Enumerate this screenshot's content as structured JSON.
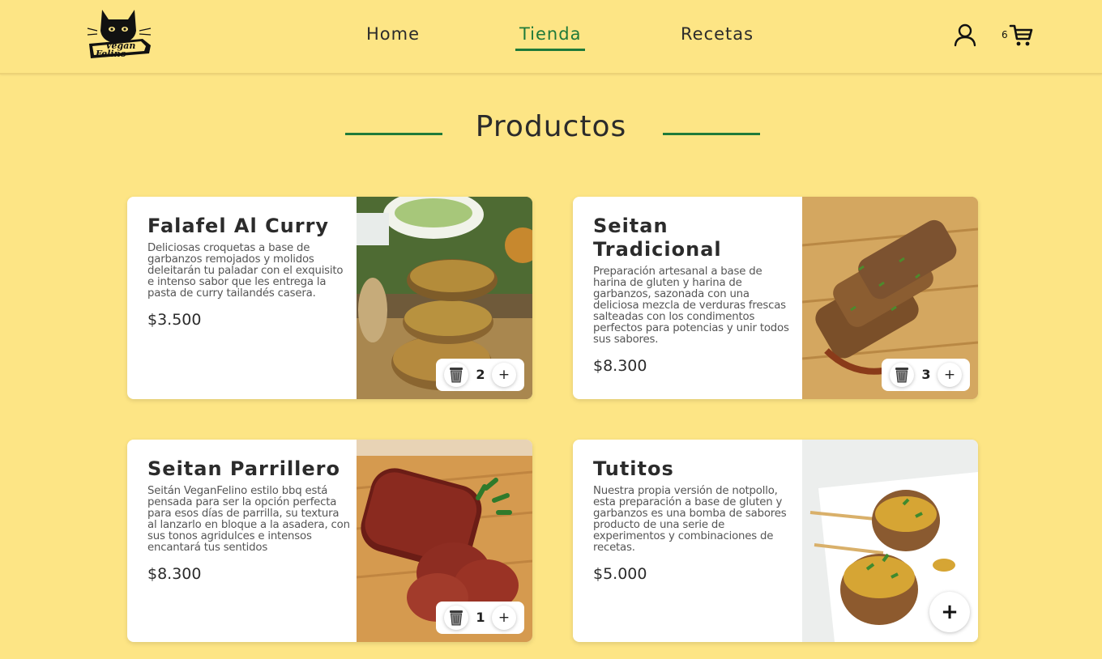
{
  "header": {
    "logo_text": "Vegan Felino",
    "nav": [
      {
        "label": "Home",
        "active": false
      },
      {
        "label": "Tienda",
        "active": true
      },
      {
        "label": "Recetas",
        "active": false
      }
    ],
    "cart_count": "6",
    "user_icon": "user-icon",
    "cart_icon": "shopping-cart-icon"
  },
  "section": {
    "title": "Productos"
  },
  "products": [
    {
      "name": "Falafel Al Curry",
      "description": "Deliciosas croquetas a base de garbanzos remojados y molidos deleitarán tu paladar con el exquisito e intenso sabor que les entrega la pasta de curry tailandés casera.",
      "price": "$3.500",
      "quantity": "2",
      "image": "falafel stack"
    },
    {
      "name": "Seitan Tradicional",
      "description": "Preparación artesanal a base de harina de gluten y harina de garbanzos, sazonada con una deliciosa mezcla de verduras frescas salteadas con los condimentos perfectos para potencias y unir todos sus sabores.",
      "price": "$8.300",
      "quantity": "3",
      "image": "sliced seitan"
    },
    {
      "name": "Seitan Parrillero",
      "description": "Seitán VeganFelino estilo bbq está pensada para ser la opción perfecta para esos días de parrilla, su textura al lanzarlo en bloque a la asadera, con sus tonos agridulces e intensos encantará tus sentidos",
      "price": "$8.300",
      "quantity": "1",
      "image": "bbq seitan"
    },
    {
      "name": "Tutitos",
      "description": "Nuestra propia versión de notpollo, esta preparación a base de gluten y garbanzos es una bomba de sabores producto de una serie de experimentos y combinaciones de recetas.",
      "price": "$5.000",
      "quantity": "",
      "image": "tutitos skewers"
    }
  ],
  "controls": {
    "plus": "+",
    "add": "+",
    "trash_icon": "trash-icon"
  },
  "colors": {
    "background": "#fde585",
    "accent": "#1f7a3a",
    "card": "#ffffff"
  }
}
